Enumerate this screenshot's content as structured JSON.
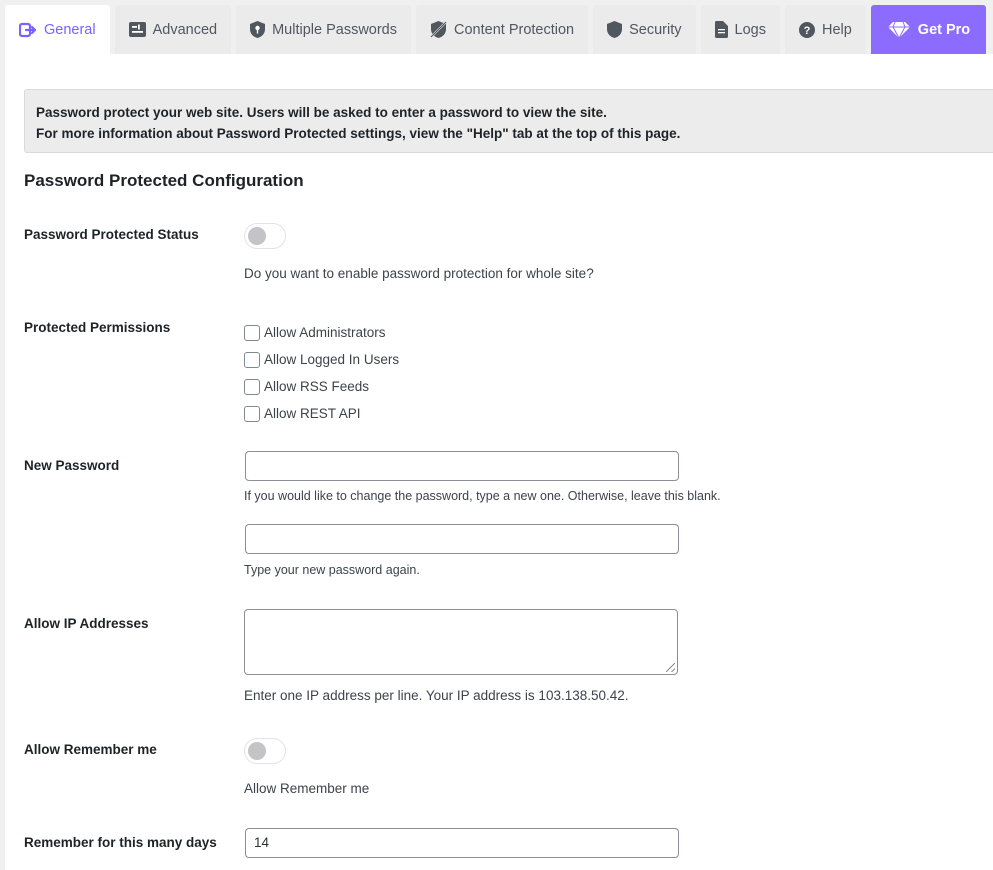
{
  "tabs": [
    {
      "label": "General",
      "icon": "sign-in-icon",
      "active": true
    },
    {
      "label": "Advanced",
      "icon": "sliders-icon"
    },
    {
      "label": "Multiple Passwords",
      "icon": "shield-key-icon"
    },
    {
      "label": "Content Protection",
      "icon": "shield-slash-icon"
    },
    {
      "label": "Security",
      "icon": "shield-icon"
    },
    {
      "label": "Logs",
      "icon": "document-icon"
    },
    {
      "label": "Help",
      "icon": "question-circle-icon"
    },
    {
      "label": "Get Pro",
      "icon": "diamond-icon"
    }
  ],
  "colors": {
    "accent": "#7b61ff",
    "pro_background": "#8b6cff"
  },
  "notice": {
    "line1": "Password protect your web site. Users will be asked to enter a password to view the site.",
    "line2": "For more information about Password Protected settings, view the \"Help\" tab at the top of this page."
  },
  "section_title": "Password Protected Configuration",
  "status": {
    "label": "Password Protected Status",
    "enabled": false,
    "help": "Do you want to enable password protection for whole site?"
  },
  "permissions": {
    "label": "Protected Permissions",
    "options": [
      {
        "label": "Allow Administrators",
        "checked": false
      },
      {
        "label": "Allow Logged In Users",
        "checked": false
      },
      {
        "label": "Allow RSS Feeds",
        "checked": false
      },
      {
        "label": "Allow REST API",
        "checked": false
      }
    ]
  },
  "new_password": {
    "label": "New Password",
    "value": "",
    "help": "If you would like to change the password, type a new one. Otherwise, leave this blank.",
    "confirm_value": "",
    "confirm_help": "Type your new password again."
  },
  "allow_ip": {
    "label": "Allow IP Addresses",
    "value": "",
    "help": "Enter one IP address per line. Your IP address is 103.138.50.42."
  },
  "remember_me": {
    "label": "Allow Remember me",
    "enabled": false,
    "help": "Allow Remember me"
  },
  "remember_days": {
    "label": "Remember for this many days",
    "value": "14"
  }
}
